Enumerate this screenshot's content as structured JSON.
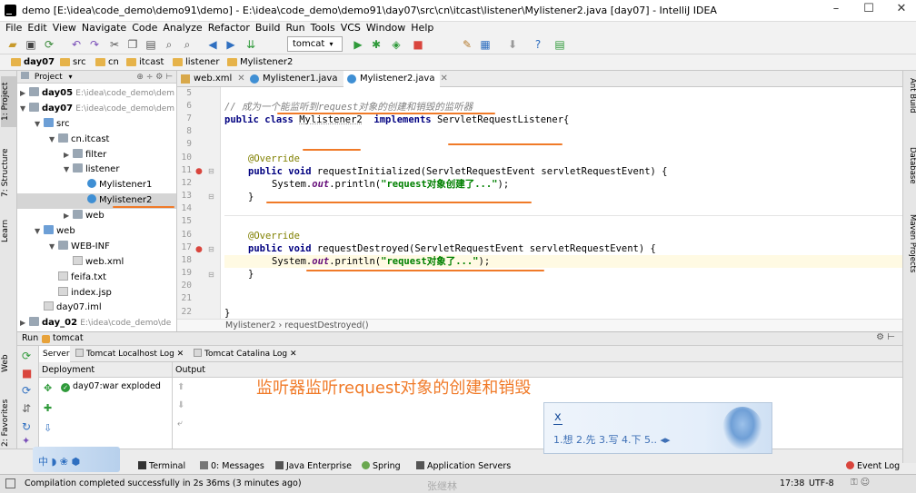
{
  "window": {
    "title": "demo [E:\\idea\\code_demo\\demo91\\demo] - E:\\idea\\code_demo\\demo91\\day07\\src\\cn\\itcast\\listener\\Mylistener2.java [day07] - IntelliJ IDEA",
    "minimize": "–",
    "maximize": "☐",
    "close": "✕"
  },
  "menu": [
    "File",
    "Edit",
    "View",
    "Navigate",
    "Code",
    "Analyze",
    "Refactor",
    "Build",
    "Run",
    "Tools",
    "VCS",
    "Window",
    "Help"
  ],
  "toolbar": {
    "run_config": "tomcat"
  },
  "breadcrumbs": [
    "day07",
    "src",
    "cn",
    "itcast",
    "listener",
    "Mylistener2"
  ],
  "left_tabs": [
    "1: Project",
    "7: Structure",
    "Learn",
    "Web",
    "2: Favorites"
  ],
  "project_panel": {
    "title": "Project"
  },
  "tree": [
    {
      "label": "day05",
      "path": "E:\\idea\\code_demo\\dem"
    },
    {
      "label": "day07",
      "path": "E:\\idea\\code_demo\\dem"
    },
    {
      "label": "src"
    },
    {
      "label": "cn.itcast"
    },
    {
      "label": "filter"
    },
    {
      "label": "listener"
    },
    {
      "label": "Mylistener1"
    },
    {
      "label": "Mylistener2"
    },
    {
      "label": "web"
    },
    {
      "label": "web"
    },
    {
      "label": "WEB-INF"
    },
    {
      "label": "web.xml"
    },
    {
      "label": "feifa.txt"
    },
    {
      "label": "index.jsp"
    },
    {
      "label": "day07.iml"
    },
    {
      "label": "day_02",
      "path": "E:\\idea\\code_demo\\de"
    }
  ],
  "editor_tabs": [
    "web.xml",
    "Mylistener1.java",
    "Mylistener2.java"
  ],
  "line_numbers": [
    "5",
    "6",
    "7",
    "8",
    "9",
    "10",
    "11",
    "12",
    "13",
    "14",
    "15",
    "16",
    "17",
    "18",
    "19",
    "20",
    "21",
    "22"
  ],
  "code": {
    "l6": "// 成为一个能监听到request对象的创建和销毁的监听器",
    "l7_kw1": "public",
    "l7_kw2": "class",
    "l7_name": "Mylistener2",
    "l7_kw3": "implements",
    "l7_iface": "ServletRequestListener{",
    "l10": "@Override",
    "l11_kw": "public void",
    "l11_rest": " requestInitialized(ServletRequestEvent servletRequestEvent) {",
    "l12_a": "System.",
    "l12_f": "out",
    "l12_b": ".println(",
    "l12_s": "\"request对象创建了...\"",
    "l12_c": ");",
    "l13": "}",
    "l15": "@Override",
    "l16_kw": "public void",
    "l16_rest": " requestDestroyed(ServletRequestEvent servletRequestEvent) {",
    "l17_a": "System.",
    "l17_f": "out",
    "l17_b": ".println(",
    "l17_s": "\"request对象了...\"",
    "l17_c": ");",
    "l18": "}",
    "l21": "}"
  },
  "editor_breadcrumb": "Mylistener2 › requestDestroyed()",
  "right_tabs": [
    "Ant Build",
    "Database",
    "Maven Projects"
  ],
  "run": {
    "label": "Run",
    "config": "tomcat",
    "tabs": [
      "Server",
      "Tomcat Localhost Log",
      "Tomcat Catalina Log"
    ],
    "deployment_header": "Deployment",
    "output_header": "Output",
    "deployment_item": "day07:war exploded"
  },
  "overlay_text": "监听器监听request对象的创建和销毁",
  "ime": {
    "input": "x",
    "candidates": "1.想  2.先  3.写  4.下  5.."
  },
  "bottom_tabs": [
    "Terminal",
    "0: Messages",
    "Java Enterprise",
    "Spring",
    "Application Servers",
    "Event Log"
  ],
  "status": {
    "message": "Compilation completed successfully in 2s 36ms (3 minutes ago)",
    "watermark": "张继林",
    "time": "17:38",
    "encoding": "UTF-8"
  },
  "colors": {
    "accent": "#f07a28",
    "selection": "#d5d5d5"
  }
}
